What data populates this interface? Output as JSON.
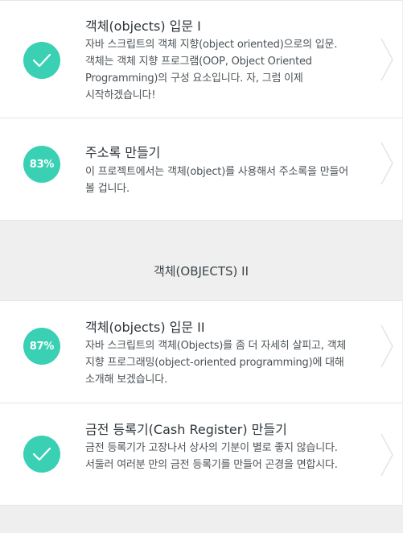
{
  "lessons_section_1": [
    {
      "title": "객체(objects) 입문 I",
      "description": "자바 스크립트의 객체 지향(object oriented)으로의 입문. 객체는 객체 지향 프로그램(OOP, Object Oriented Programming)의 구성 요소입니다. 자, 그럼 이제 시작하겠습니다!",
      "status": "completed",
      "status_icon": "checkmark-icon"
    },
    {
      "title": "주소록 만들기",
      "description": "이 프로젝트에서는 객체(object)를 사용해서 주소록을 만들어 볼 겁니다.",
      "status": "in-progress",
      "progress_label": "83%"
    }
  ],
  "section_2": {
    "title": "객체(OBJECTS) II"
  },
  "lessons_section_2": [
    {
      "title": "객체(objects) 입문 II",
      "description": "자바 스크립트의 객체(Objects)를 좀 더 자세히 살피고, 객체 지향 프로그래밍(object-oriented programming)에 대해 소개해 보겠습니다.",
      "status": "in-progress",
      "progress_label": "87%"
    },
    {
      "title": "금전 등록기(Cash Register) 만들기",
      "description": "금전 등록기가 고장나서 상사의 기분이 별로 좋지 않습니다. 서둘러 여러분 만의 금전 등록기를 만들어 곤경을 면합시다.",
      "status": "completed",
      "status_icon": "checkmark-icon"
    }
  ],
  "colors": {
    "accent": "#39d0b4",
    "card_background": "#ffffff",
    "page_background": "#eeefee",
    "chevron": "#e2e4e5"
  }
}
